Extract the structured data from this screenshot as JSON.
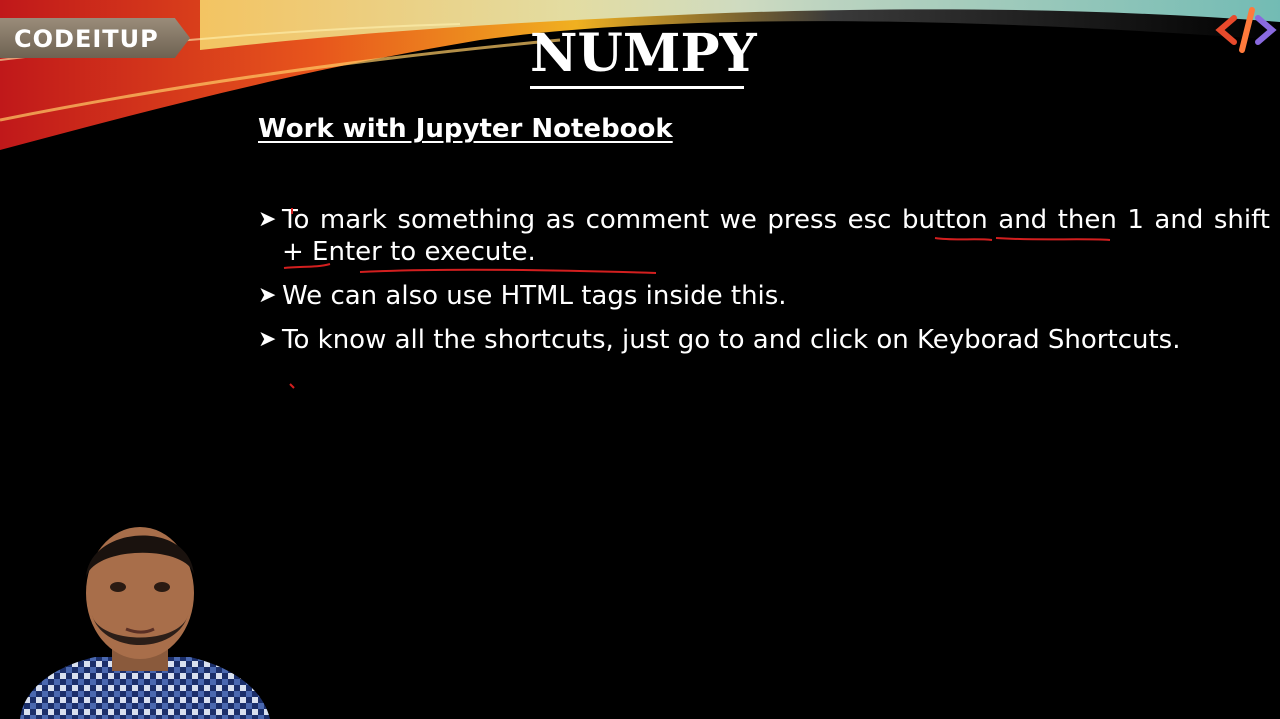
{
  "brand": {
    "badge": "CODEITUP",
    "logo_icon": "code-brackets-logo"
  },
  "slide": {
    "title": "NUMPY",
    "subtitle": "Work with Jupyter Notebook",
    "bullets": [
      "To mark something as comment we press esc button and then 1 and shift + Enter to execute.",
      "We can also use HTML tags inside this.",
      "To know all the shortcuts, just go to and click on Keyborad Shortcuts."
    ],
    "bullet_icon": "arrow-bullet-icon"
  },
  "colors": {
    "annotation": "#d31f1f",
    "background": "#000000",
    "text": "#ffffff",
    "banner_orange": "#e8561c",
    "banner_yellow": "#f0b020",
    "banner_teal": "#7fd0c8"
  }
}
